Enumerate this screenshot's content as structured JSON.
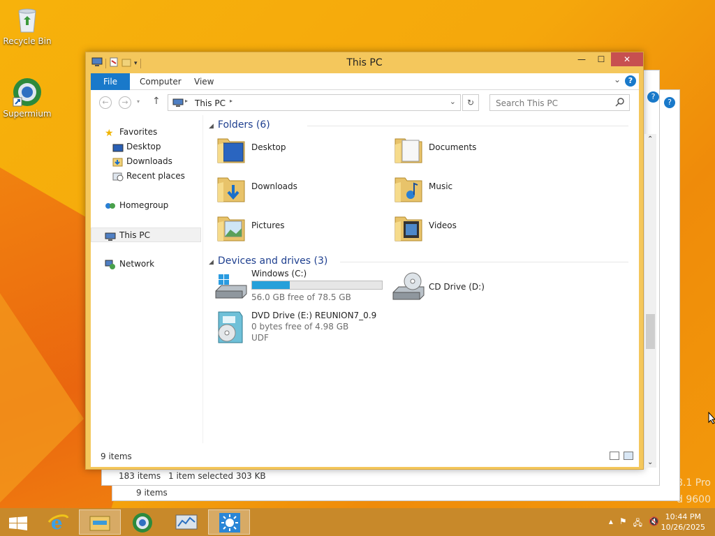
{
  "desktop": {
    "icons": [
      {
        "label": "Recycle Bin"
      },
      {
        "label": "Supermium"
      }
    ],
    "watermark_lines": [
      "8.1 Pro",
      "d 9600"
    ]
  },
  "window": {
    "title": "This PC",
    "ribbon": {
      "tabs": [
        "File",
        "Computer",
        "View"
      ],
      "help": "?"
    },
    "address": {
      "path": "This PC",
      "search_placeholder": "Search This PC"
    },
    "sidebar": {
      "favorites": "Favorites",
      "items": [
        "Desktop",
        "Downloads",
        "Recent places"
      ],
      "homegroup": "Homegroup",
      "this_pc": "This PC",
      "network": "Network"
    },
    "folders_header": "Folders (6)",
    "folders": [
      "Desktop",
      "Documents",
      "Downloads",
      "Music",
      "Pictures",
      "Videos"
    ],
    "devices_header": "Devices and drives (3)",
    "drives": [
      {
        "name": "Windows (C:)",
        "free": "56.0 GB free of 78.5 GB",
        "used_fraction": 0.29
      },
      {
        "name": "CD Drive (D:)"
      },
      {
        "name": "DVD Drive (E:) REUNION7_0.9",
        "free": "0 bytes free of 4.98 GB",
        "fs": "UDF"
      }
    ],
    "status": "9 items"
  },
  "behind": {
    "status_items": "183 items",
    "status_selected": "1 item selected  303 KB",
    "status2": "9 items"
  },
  "taskbar": {
    "time": "10:44 PM",
    "date": "10/26/2025"
  }
}
